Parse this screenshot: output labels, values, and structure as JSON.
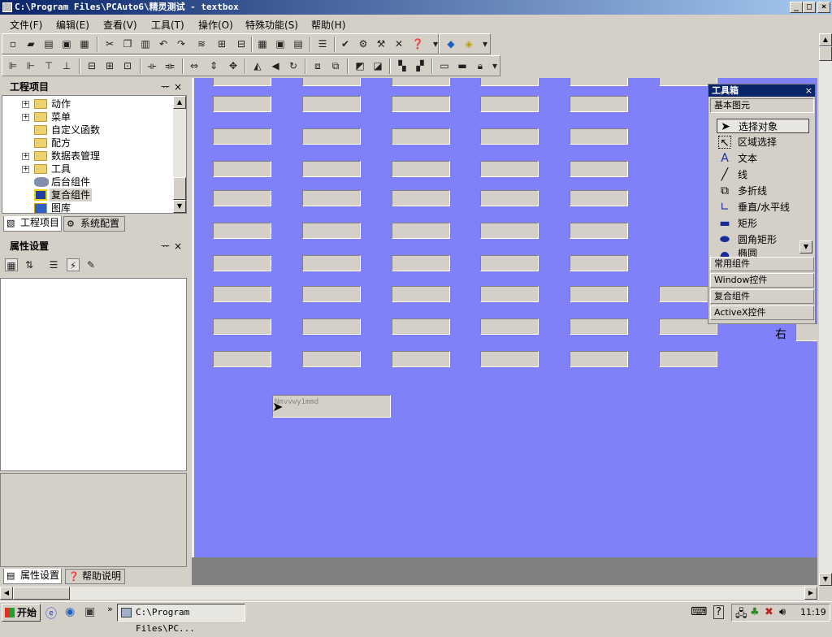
{
  "window": {
    "title": "C:\\Program Files\\PCAuto6\\精灵测试 - textbox",
    "min": "_",
    "max": "□",
    "close": "×"
  },
  "menu": [
    "文件(F)",
    "编辑(E)",
    "查看(V)",
    "工具(T)",
    "操作(O)",
    "特殊功能(S)",
    "帮助(H)"
  ],
  "project_panel": {
    "title": "工程项目",
    "pin": "ᅲ",
    "close": "×",
    "tree": [
      {
        "label": "动作",
        "expandable": true
      },
      {
        "label": "菜单",
        "expandable": true
      },
      {
        "label": "自定义函数",
        "expandable": false
      },
      {
        "label": "配方",
        "expandable": false
      },
      {
        "label": "数据表管理",
        "expandable": true
      },
      {
        "label": "工具",
        "expandable": true
      },
      {
        "label": "后台组件",
        "expandable": false
      },
      {
        "label": "复合组件",
        "expandable": false
      },
      {
        "label": "图库",
        "expandable": false
      }
    ],
    "tabs": [
      "工程项目",
      "系统配置"
    ]
  },
  "property_panel": {
    "title": "属性设置",
    "pin": "ᅲ",
    "close": "×",
    "tabs": [
      "属性设置",
      "帮助说明"
    ]
  },
  "canvas": {
    "dragging_textbox_text": "Nmvvwy1mmd",
    "side_label": "右"
  },
  "toolbox": {
    "title": "工具箱",
    "close": "×",
    "active_section": "基本图元",
    "items": [
      {
        "icon": "arrow-pointer-icon",
        "label": "选择对象",
        "selected": true
      },
      {
        "icon": "region-select-icon",
        "label": "区域选择"
      },
      {
        "icon": "text-icon",
        "label": "文本"
      },
      {
        "icon": "line-icon",
        "label": "线"
      },
      {
        "icon": "polyline-icon",
        "label": "多折线"
      },
      {
        "icon": "orthogonal-line-icon",
        "label": "垂直/水平线"
      },
      {
        "icon": "rectangle-icon",
        "label": "矩形"
      },
      {
        "icon": "rounded-rect-icon",
        "label": "圆角矩形"
      },
      {
        "icon": "ellipse-icon",
        "label": "椭圆"
      }
    ],
    "sections": [
      "常用组件",
      "Window控件",
      "复合组件",
      "ActiveX控件"
    ]
  },
  "taskbar": {
    "start": "开始",
    "task": "C:\\Program Files\\PC...",
    "time": "11:19"
  },
  "colors": {
    "canvas": "#8080f8",
    "titlebar": "#0a246a",
    "textbox": "#d4d0c8"
  }
}
